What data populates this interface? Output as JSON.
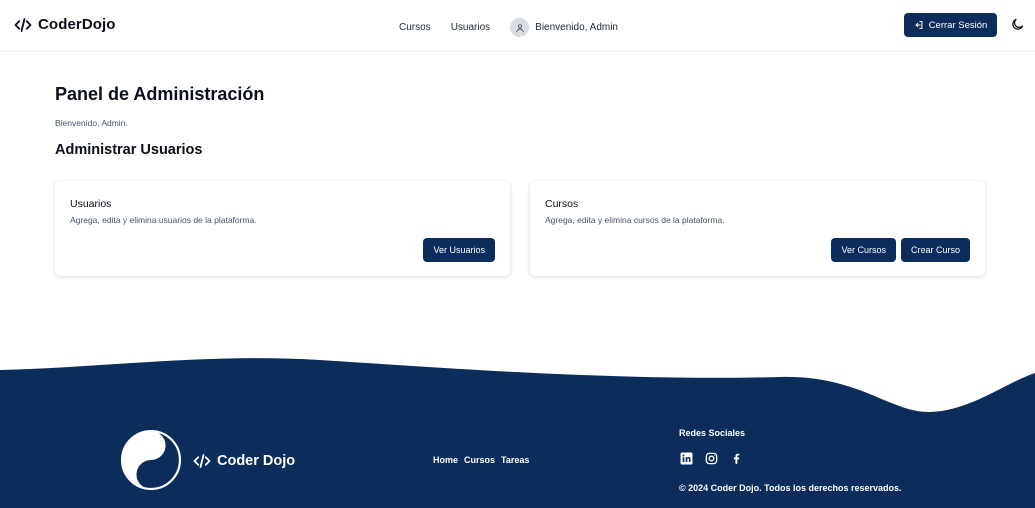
{
  "header": {
    "brand": "CoderDojo",
    "nav": [
      "Cursos",
      "Usuarios"
    ],
    "welcome": "Bienvenido, Admin",
    "logout_label": "Cerrar Sesión",
    "theme_icon": "moon-icon"
  },
  "main": {
    "title": "Panel de Administración",
    "subtitle": "Bienvenido, Admin.",
    "section_title": "Administrar Usuarios",
    "cards": [
      {
        "title": "Usuarios",
        "description": "Agrega, edita y elimina usuarios de la plataforma.",
        "buttons": [
          "Ver Usuarios"
        ]
      },
      {
        "title": "Cursos",
        "description": "Agrega, edita y elimina cursos de la plataforma.",
        "buttons": [
          "Ver Cursos",
          "Crear Curso"
        ]
      }
    ]
  },
  "footer": {
    "brand": "Coder Dojo",
    "links": [
      "Home",
      "Cursos",
      "Tareas"
    ],
    "social_title": "Redes Sociales",
    "social_icons": [
      "linkedin-icon",
      "instagram-icon",
      "facebook-icon"
    ],
    "copyright": "© 2024 Coder Dojo. Todos los derechos reservados."
  },
  "colors": {
    "primary": "#0c2d5c",
    "background": "#ffffff",
    "text": "#0b0f19",
    "muted": "#475569"
  }
}
